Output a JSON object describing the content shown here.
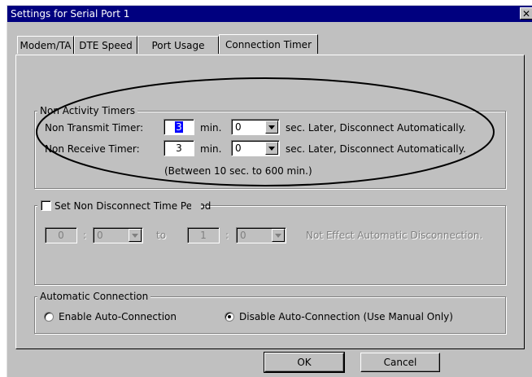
{
  "window": {
    "title": "Settings for Serial Port 1",
    "close_glyph": "✕"
  },
  "tabs": [
    {
      "label": "Modem/TA",
      "active": false
    },
    {
      "label": "DTE Speed",
      "active": false
    },
    {
      "label": "Port Usage",
      "active": false
    },
    {
      "label": "Connection Timer",
      "active": true
    }
  ],
  "non_activity": {
    "group_label": "Non Activity Timers",
    "transmit_label": "Non Transmit Timer:",
    "transmit_min": "3",
    "transmit_sec": "0",
    "receive_label": "Non Receive Timer:",
    "receive_min": "3",
    "receive_sec": "0",
    "min_unit": "min.",
    "sec_suffix": "sec. Later, Disconnect Automatically.",
    "range_note": "(Between 10 sec. to 600 min.)"
  },
  "non_disconnect": {
    "checkbox_label": "Set Non Disconnect Time Period",
    "checked": false,
    "start_hour": "0",
    "start_min": "0",
    "end_hour": "1",
    "end_min": "0",
    "colon": ":",
    "to_label": "to",
    "suffix": "Not Effect Automatic Disconnection."
  },
  "auto_connection": {
    "group_label": "Automatic Connection",
    "enable_label": "Enable Auto-Connection",
    "disable_label": "Disable Auto-Connection (Use Manual Only)",
    "selected": "disable"
  },
  "buttons": {
    "ok_label": "OK",
    "cancel_label": "Cancel"
  },
  "colors": {
    "face": "#c0c0c0",
    "title_bg": "#00007f",
    "highlight": "#0000ff"
  }
}
